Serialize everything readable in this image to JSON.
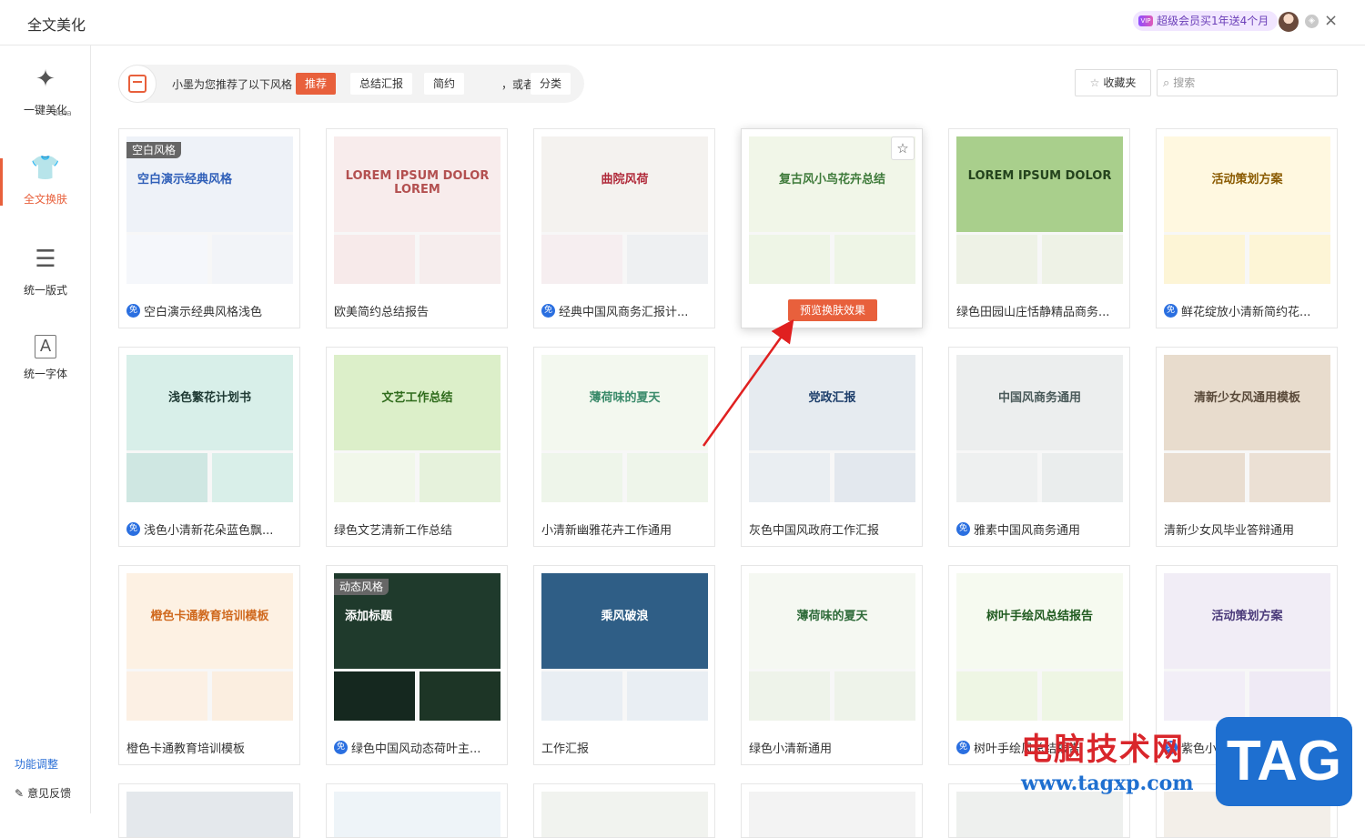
{
  "app": {
    "title": "全文美化"
  },
  "header": {
    "vip_text": "超级会员买1年送4个月",
    "vip_icon_text": "VIP",
    "close_icon": "×"
  },
  "sidebar": {
    "beta": "Beta",
    "items": [
      {
        "label": "一键美化",
        "icon": "magic-wand-icon"
      },
      {
        "label": "全文换肤",
        "icon": "tshirt-icon",
        "active": true
      },
      {
        "label": "统一版式",
        "icon": "layout-icon"
      },
      {
        "label": "统一字体",
        "icon": "font-icon"
      }
    ],
    "func_adjust": "功能调整",
    "feedback": "意见反馈"
  },
  "recommend": {
    "text": "小墨为您推荐了以下风格",
    "chips": [
      "推荐",
      "总结汇报",
      "简约"
    ],
    "or_try": "，或者试试",
    "category": "分类"
  },
  "toolbar": {
    "favorites": "收藏夹",
    "search_placeholder": "搜索"
  },
  "colors": {
    "accent": "#e8603c",
    "free_badge": "#2a6fe0"
  },
  "templates": [
    {
      "title": "空白演示经典风格浅色",
      "free": true,
      "corner": "空白风格",
      "thumb_title": "空白演示经典风格"
    },
    {
      "title": "欧美简约总结报告",
      "free": false,
      "thumb_title": "LOREM IPSUM DOLOR LOREM"
    },
    {
      "title": "经典中国风商务汇报计...",
      "free": true,
      "thumb_title": "曲院风荷"
    },
    {
      "title": "复古风小鸟花卉总结",
      "free": false,
      "hover": true,
      "thumb_title": "复古风小鸟花卉总结",
      "preview": "预览换肤效果"
    },
    {
      "title": "绿色田园山庄恬静精品商务...",
      "free": false,
      "thumb_title": "LOREM IPSUM DOLOR"
    },
    {
      "title": "鲜花绽放小清新简约花...",
      "free": true,
      "thumb_title": "活动策划方案"
    },
    {
      "title": "浅色小清新花朵蓝色飘...",
      "free": true,
      "thumb_title": "浅色繁花计划书"
    },
    {
      "title": "绿色文艺清新工作总结",
      "free": false,
      "thumb_title": "文艺工作总结"
    },
    {
      "title": "小清新幽雅花卉工作通用",
      "free": false,
      "thumb_title": "薄荷味的夏天"
    },
    {
      "title": "灰色中国风政府工作汇报",
      "free": false,
      "thumb_title": "党政汇报"
    },
    {
      "title": "雅素中国风商务通用",
      "free": true,
      "thumb_title": "中国风商务通用"
    },
    {
      "title": "清新少女风毕业答辩通用",
      "free": false,
      "thumb_title": "清新少女风通用模板"
    },
    {
      "title": "橙色卡通教育培训模板",
      "free": false,
      "thumb_title": "橙色卡通教育培训模板"
    },
    {
      "title": "绿色中国风动态荷叶主...",
      "free": true,
      "corner": "动态风格",
      "thumb_title": "添加标题"
    },
    {
      "title": "工作汇报",
      "free": false,
      "thumb_title": "乘风破浪"
    },
    {
      "title": "绿色小清新通用",
      "free": false,
      "thumb_title": "薄荷味的夏天"
    },
    {
      "title": "树叶手绘风总结报告",
      "free": true,
      "thumb_title": "树叶手绘风总结报告"
    },
    {
      "title": "紫色小清新活动策划方案",
      "free": true,
      "thumb_title": "活动策划方案"
    }
  ],
  "watermark": {
    "cn": "电脑技术网",
    "url": "www.tagxp.com",
    "tag": "TAG"
  }
}
